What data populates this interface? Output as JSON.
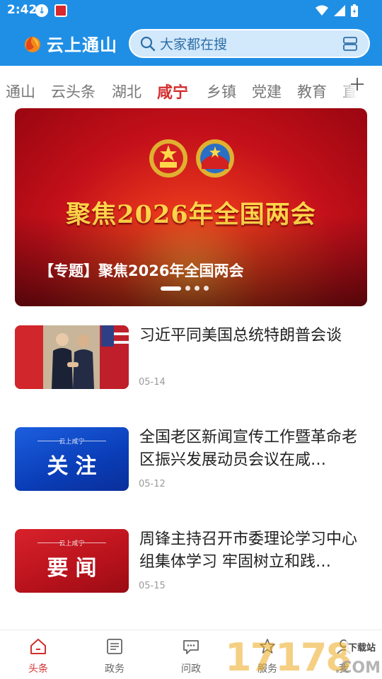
{
  "status_bar": {
    "time": "2:42"
  },
  "app": {
    "name": "云上通山"
  },
  "search": {
    "placeholder": "大家都在搜"
  },
  "tabs": [
    {
      "label": "通山"
    },
    {
      "label": "云头条"
    },
    {
      "label": "湖北"
    },
    {
      "label": "咸宁",
      "active": true
    },
    {
      "label": "乡镇"
    },
    {
      "label": "党建"
    },
    {
      "label": "教育"
    },
    {
      "label": "直"
    }
  ],
  "banner": {
    "heading": "聚焦2026年全国两会",
    "caption": "【专题】聚焦2026年全国两会",
    "slide_count": 4,
    "active_slide": 1
  },
  "news": [
    {
      "title": "习近平同美国总统特朗普会谈",
      "date": "05-14",
      "thumb": "photo"
    },
    {
      "title": "全国老区新闻宣传工作暨革命老区振兴发展动员会议在咸…",
      "date": "05-12",
      "thumb_word": "关注",
      "thumb_tag": "云上咸宁"
    },
    {
      "title": "周锋主持召开市委理论学习中心组集体学习 牢固树立和践…",
      "date": "05-15",
      "thumb_word": "要闻",
      "thumb_tag": "云上咸宁"
    }
  ],
  "bottom_nav": [
    {
      "label": "头条",
      "icon": "home-icon",
      "active": true
    },
    {
      "label": "政务",
      "icon": "news-icon"
    },
    {
      "label": "问政",
      "icon": "chat-icon"
    },
    {
      "label": "服务",
      "icon": "star-icon"
    },
    {
      "label": "我",
      "icon": "user-icon"
    }
  ],
  "watermark": {
    "number": "17178",
    "tag": "下载站",
    "suffix": ".COM"
  },
  "colors": {
    "brand_blue": "#1f8fe6",
    "accent_red": "#d32f2f"
  }
}
